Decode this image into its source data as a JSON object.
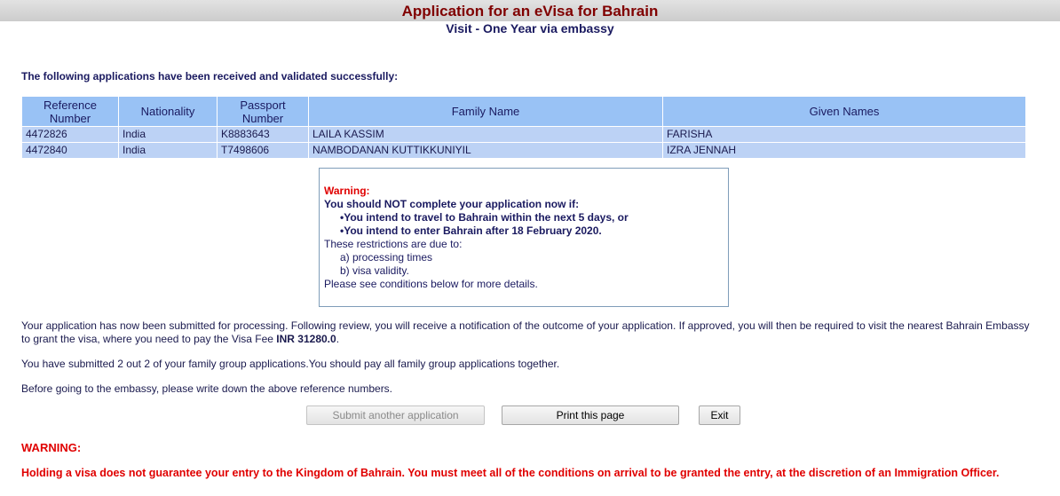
{
  "header": {
    "title": "Application for an eVisa for Bahrain",
    "subtitle": "Visit - One Year via embassy"
  },
  "intro": "The following applications have been received and validated successfully:",
  "table": {
    "columns": [
      "Reference Number",
      "Nationality",
      "Passport Number",
      "Family Name",
      "Given Names"
    ],
    "rows": [
      [
        "4472826",
        "India",
        "K8883643",
        "LAILA KASSIM",
        "FARISHA"
      ],
      [
        "4472840",
        "India",
        "T7498606",
        "NAMBODANAN KUTTIKKUNIYIL",
        "IZRA JENNAH"
      ]
    ]
  },
  "warning_box": {
    "title": "Warning:",
    "line1": "You should NOT complete your application now if:",
    "bullet1": "•You intend to travel to Bahrain within the next 5 days, or",
    "bullet2": "•You intend to enter Bahrain after 18 February 2020.",
    "line2": "These restrictions are due to:",
    "reason1": "a) processing times",
    "reason2": "b) visa validity.",
    "line3": "Please see conditions below for more details."
  },
  "body": {
    "para1": "Your application has now been submitted for processing. Following review, you will receive a notification of the outcome of your application. If approved, you will then be required to visit the nearest Bahrain Embassy to grant the visa, where you need to pay the Visa Fee ",
    "fee": "INR 31280.0",
    "fee_suffix": ".",
    "para2": "You have submitted 2 out 2 of your family group applications.You should pay all family group applications together.",
    "para3": "Before going to the embassy, please write down the above reference numbers."
  },
  "buttons": {
    "submit_another": "Submit another application",
    "print": "Print this page",
    "exit": "Exit"
  },
  "footer": {
    "warning_title": "WARNING:",
    "warning_text": "Holding a visa does not guarantee your entry to the Kingdom of Bahrain. You must meet all of the conditions on arrival to be granted the entry, at the discretion of an Immigration Officer."
  }
}
